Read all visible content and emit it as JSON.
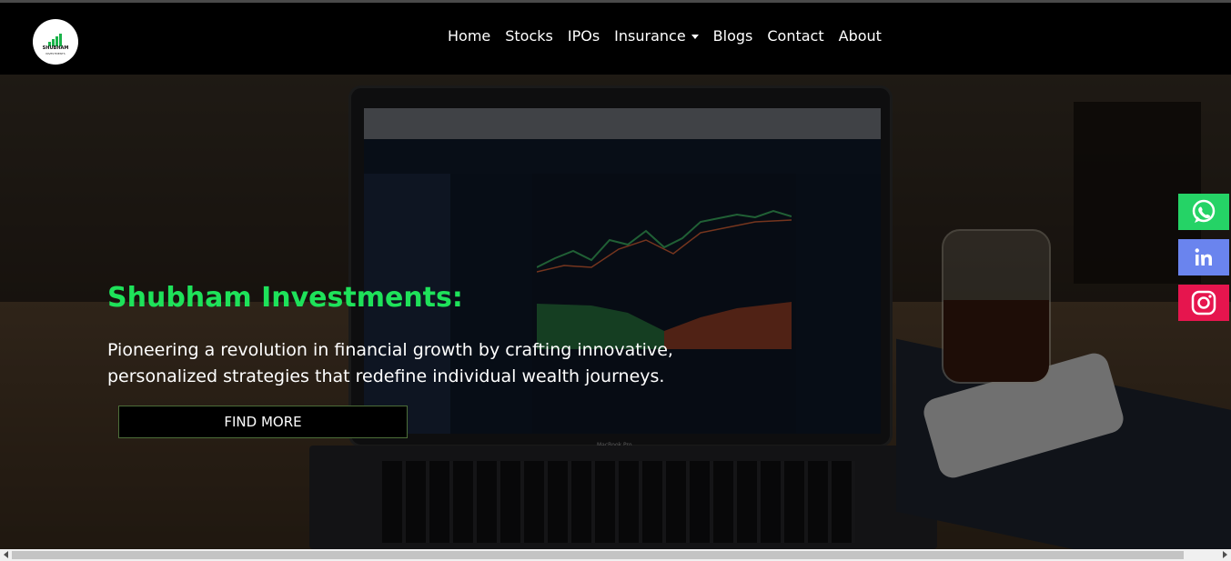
{
  "brand": {
    "logo_text": "SHUBHAM",
    "logo_subtext": "INVESTMENTS",
    "logo_color": "#1bb34a"
  },
  "nav": {
    "items": [
      {
        "label": "Home"
      },
      {
        "label": "Stocks"
      },
      {
        "label": "IPOs"
      },
      {
        "label": "Insurance",
        "has_dropdown": true
      },
      {
        "label": "Blogs"
      },
      {
        "label": "Contact"
      },
      {
        "label": "About"
      }
    ]
  },
  "hero": {
    "title": "Shubham Investments:",
    "subtitle": "Pioneering a revolution in financial growth by crafting innovative, personalized strategies that redefine individual wealth journeys.",
    "cta_label": "FIND MORE",
    "title_color": "#1ee25a",
    "laptop_label": "MacBook Pro"
  },
  "social": [
    {
      "name": "whatsapp",
      "icon": "whatsapp-icon",
      "color": "#25d366"
    },
    {
      "name": "linkedin",
      "icon": "linkedin-icon",
      "color": "#6a84ee"
    },
    {
      "name": "instagram",
      "icon": "instagram-icon",
      "color": "#e6154e"
    }
  ]
}
